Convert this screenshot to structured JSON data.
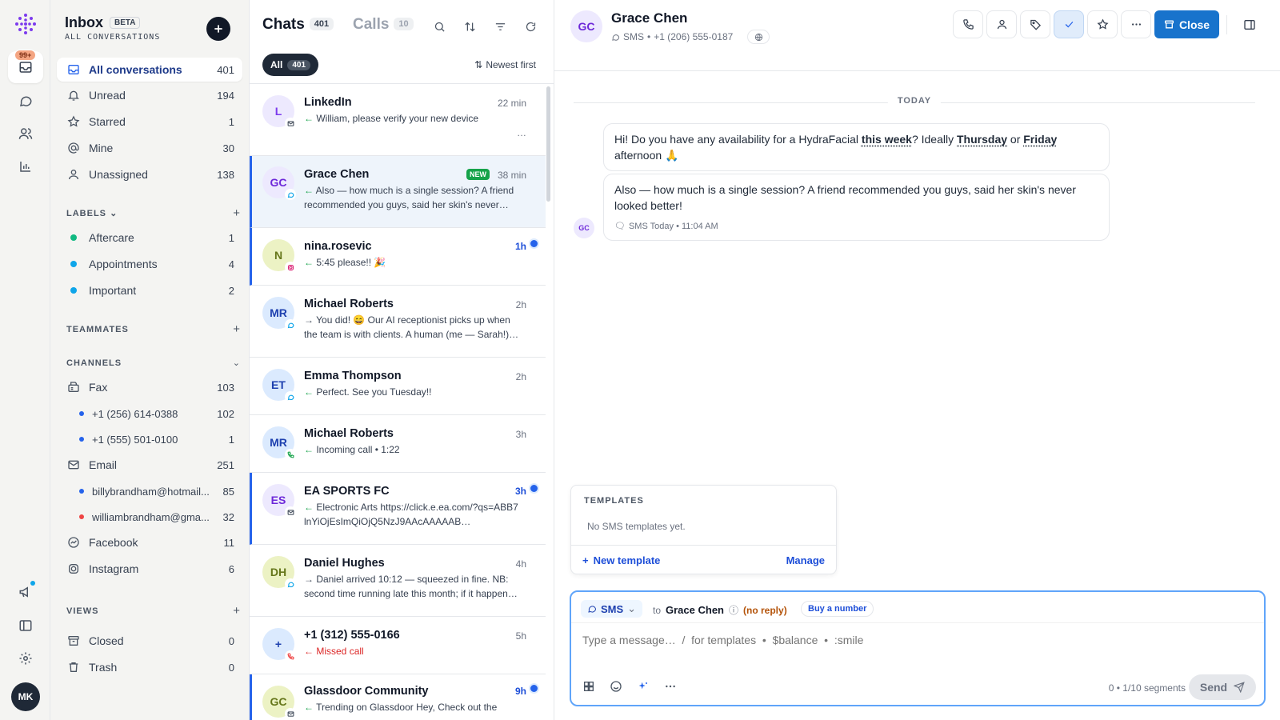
{
  "app": {
    "title": "Inbox",
    "beta": "BETA",
    "subtitle": "ALL CONVERSATIONS",
    "avatar_initials": "MK",
    "rail_badge": "99+"
  },
  "colors": {
    "accent": "#2563eb",
    "primary_button": "#1873cc",
    "new_badge": "#16a34a",
    "unread_dot": "#2563eb",
    "warning": "#b45309"
  },
  "rail": {
    "icons": [
      "logo-icon",
      "inbox-icon",
      "chat-bubble-icon",
      "contacts-icon",
      "reports-icon",
      "megaphone-icon",
      "panel-icon",
      "settings-icon"
    ]
  },
  "nav": [
    {
      "label": "All conversations",
      "count": "401",
      "icon": "inbox-icon"
    },
    {
      "label": "Unread",
      "count": "194",
      "icon": "bell-icon"
    },
    {
      "label": "Starred",
      "count": "1",
      "icon": "star-icon"
    },
    {
      "label": "Mine",
      "count": "30",
      "icon": "at-icon"
    },
    {
      "label": "Unassigned",
      "count": "138",
      "icon": "person-icon"
    }
  ],
  "labels": {
    "title": "LABELS",
    "items": [
      {
        "label": "Aftercare",
        "count": "1",
        "color": "#10b981"
      },
      {
        "label": "Appointments",
        "count": "4",
        "color": "#0ea5e9"
      },
      {
        "label": "Important",
        "count": "2",
        "color": "#0ea5e9"
      }
    ]
  },
  "teammates": {
    "title": "TEAMMATES"
  },
  "channels": {
    "title": "CHANNELS",
    "items": [
      {
        "label": "Fax",
        "count": "103"
      },
      {
        "label": "+1 (256) 614-0388",
        "count": "102",
        "color": "#2563eb"
      },
      {
        "label": "+1 (555) 501-0100",
        "count": "1",
        "color": "#2563eb"
      },
      {
        "label": "Email",
        "count": "251"
      },
      {
        "label": "billybrandham@hotmail...",
        "count": "85",
        "color": "#2563eb"
      },
      {
        "label": "williambrandham@gma...",
        "count": "32",
        "color": "#ef4444"
      },
      {
        "label": "Facebook",
        "count": "11"
      },
      {
        "label": "Instagram",
        "count": "6"
      }
    ]
  },
  "views": {
    "title": "VIEWS",
    "items": [
      {
        "label": "Closed",
        "count": "0"
      },
      {
        "label": "Trash",
        "count": "0"
      }
    ]
  },
  "list": {
    "tab_chats": "Chats",
    "chats_count": "401",
    "tab_calls": "Calls",
    "calls_count": "10",
    "filter_all": "All",
    "filter_all_count": "401",
    "sort_label": "Newest first",
    "new_badge": "NEW",
    "items": [
      {
        "name": "LinkedIn",
        "initials": "L",
        "time": "22 min",
        "preview": "William, please verify your new device",
        "arrow": "←",
        "channel": "email-icon",
        "extra": "…"
      },
      {
        "name": "Grace Chen",
        "initials": "GC",
        "time": "38 min",
        "preview": "Also — how much is a single session? A friend recommended you guys, said her skin's never…",
        "arrow": "←",
        "channel": "sms-icon"
      },
      {
        "name": "nina.rosevic",
        "initials": "N",
        "time": "1h",
        "preview": "5:45 please!! 🎉",
        "arrow": "←",
        "channel": "instagram-icon"
      },
      {
        "name": "Michael Roberts",
        "initials": "MR",
        "time": "2h",
        "preview": "You did! 😄 Our AI receptionist picks up when the team is with clients. A human (me — Sarah!)…",
        "arrow": "→",
        "channel": "sms-icon"
      },
      {
        "name": "Emma Thompson",
        "initials": "ET",
        "time": "2h",
        "preview": "Perfect. See you Tuesday!!",
        "arrow": "←",
        "channel": "sms-icon"
      },
      {
        "name": "Michael Roberts",
        "initials": "MR",
        "time": "3h",
        "preview": "Incoming call • 1:22",
        "arrow": "←",
        "channel": "phone-icon"
      },
      {
        "name": "EA SPORTS FC",
        "initials": "ES",
        "time": "3h",
        "preview": "Electronic Arts https://click.e.ea.com/?qs=ABB7lnYiOjEsImQiOjQ5NzJ9AAcAAAAAB…",
        "arrow": "←",
        "channel": "email-icon"
      },
      {
        "name": "Daniel Hughes",
        "initials": "DH",
        "time": "4h",
        "preview": "Daniel arrived 10:12 — squeezed in fine. NB: second time running late this month; if it happen…",
        "arrow": "→",
        "channel": "sms-icon"
      },
      {
        "name": "+1 (312) 555-0166",
        "initials": "+",
        "time": "5h",
        "preview": "Missed call",
        "arrow": "←",
        "channel": "missed-call-icon"
      },
      {
        "name": "Glassdoor Community",
        "initials": "GC",
        "time": "9h",
        "preview": "Trending on Glassdoor Hey, Check out the",
        "arrow": "←",
        "channel": "email-icon"
      }
    ]
  },
  "conversation": {
    "contact_name": "Grace Chen",
    "initials": "GC",
    "channel": "SMS",
    "separator": "•",
    "phone": "+1 (206) 555-0187",
    "close_label": "Close",
    "day_divider": "TODAY",
    "message1": {
      "t1": "Hi! Do you have any availability for a HydraFacial ",
      "h1": "this week",
      "t2": "? Ideally ",
      "h2": "Thursday",
      "t3": " or ",
      "h3": "Friday",
      "t4": " afternoon 🙏"
    },
    "message2": "Also — how much is a single session? A friend recommended you guys, said her skin's never looked better!",
    "message_meta": "SMS  Today • 11:04 AM"
  },
  "templates": {
    "title": "TEMPLATES",
    "empty": "No SMS templates yet.",
    "new": "New template",
    "manage": "Manage"
  },
  "composer": {
    "channel": "SMS",
    "to_label": "to",
    "to_name": "Grace Chen",
    "no_reply": "(no reply)",
    "buy": "Buy a number",
    "placeholder": "Type a message…  /  for templates  •  $balance  •  :smile",
    "segments": "0 • 1/10 segments",
    "send": "Send"
  }
}
